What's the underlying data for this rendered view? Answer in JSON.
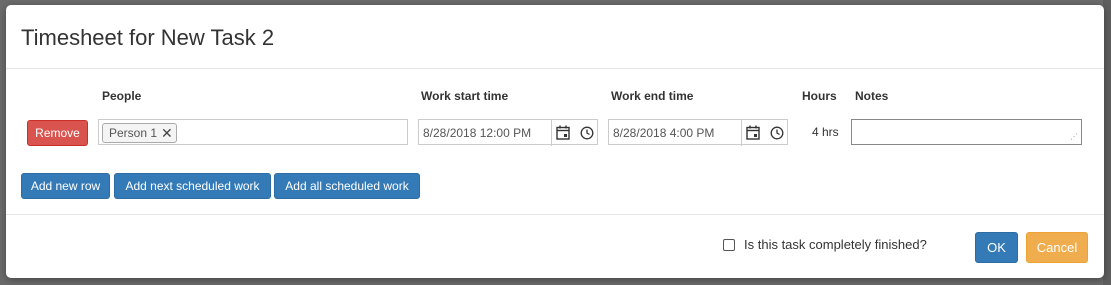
{
  "dialog": {
    "title": "Timesheet for New Task 2",
    "columns": {
      "people": "People",
      "start": "Work start time",
      "end": "Work end time",
      "hours": "Hours",
      "notes": "Notes"
    },
    "row": {
      "remove_label": "Remove",
      "person_tag": "Person 1",
      "person_tag_remove": "✕",
      "start_value": "8/28/2018 12:00 PM",
      "end_value": "8/28/2018 4:00 PM",
      "hours_value": "4 hrs",
      "notes_value": ""
    },
    "actions": {
      "add_row": "Add new row",
      "add_next": "Add next scheduled work",
      "add_all": "Add all scheduled work"
    },
    "footer": {
      "finished_label": "Is this task completely finished?",
      "finished_checked": false,
      "ok": "OK",
      "cancel": "Cancel"
    }
  },
  "icons": {
    "calendar": "calendar-icon",
    "clock": "clock-icon",
    "resize": "resize-grip-icon"
  },
  "colors": {
    "primary": "#337ab7",
    "danger": "#d9534f",
    "warning": "#f0ad4e"
  }
}
